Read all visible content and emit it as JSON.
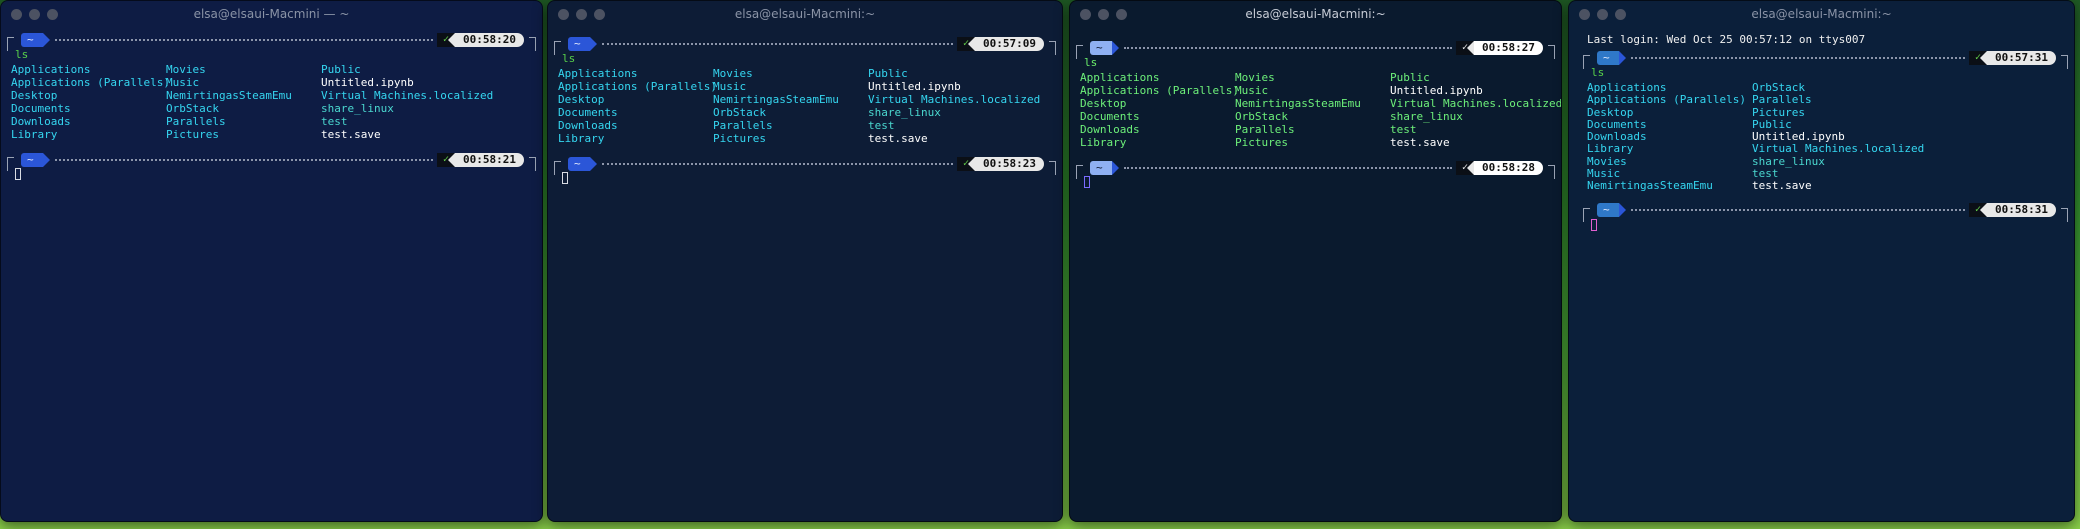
{
  "windows": [
    {
      "title": "elsa@elsaui-Macmini — ~",
      "bg": "#0e1c44",
      "prompt_dir": "~",
      "check": "✓",
      "time1": "00:58:20",
      "command": "ls",
      "time2": "00:58:21",
      "ls": {
        "col1": [
          "Applications",
          "Applications (Parallels)",
          "Desktop",
          "Documents",
          "Downloads",
          "Library"
        ],
        "col2": [
          "Movies",
          "Music",
          "NemirtingasSteamEmu",
          "OrbStack",
          "Parallels",
          "Pictures"
        ],
        "col3": [
          "Public",
          "Untitled.ipynb",
          "Virtual Machines.localized",
          "share_linux",
          "test",
          "test.save"
        ]
      }
    },
    {
      "title": "elsa@elsaui-Macmini:~",
      "bg": "#0d1c36",
      "prompt_dir": "~",
      "check": "✓",
      "time1": "00:57:09",
      "command": "ls",
      "time2": "00:58:23",
      "ls": {
        "col1": [
          "Applications",
          "Applications (Parallels)",
          "Desktop",
          "Documents",
          "Downloads",
          "Library"
        ],
        "col2": [
          "Movies",
          "Music",
          "NemirtingasSteamEmu",
          "OrbStack",
          "Parallels",
          "Pictures"
        ],
        "col3": [
          "Public",
          "Untitled.ipynb",
          "Virtual Machines.localized",
          "share_linux",
          "test",
          "test.save"
        ]
      }
    },
    {
      "title": "elsa@elsaui-Macmini:~",
      "bg": "#0a1a2e",
      "prompt_dir": "~",
      "check": "✓",
      "time1": "00:58:27",
      "command": "ls",
      "time2": "00:58:28",
      "ls": {
        "col1": [
          "Applications",
          "Applications (Parallels)",
          "Desktop",
          "Documents",
          "Downloads",
          "Library"
        ],
        "col2": [
          "Movies",
          "Music",
          "NemirtingasSteamEmu",
          "OrbStack",
          "Parallels",
          "Pictures"
        ],
        "col3": [
          "Public",
          "Untitled.ipynb",
          "Virtual Machines.localized",
          "share_linux",
          "test",
          "test.save"
        ]
      }
    },
    {
      "title": "elsa@elsaui-Macmini:~",
      "bg": "#0b1f3a",
      "login": "Last login: Wed Oct 25 00:57:12 on ttys007",
      "prompt_dir": "~",
      "check": "✓",
      "time1": "00:57:31",
      "command": "ls",
      "time2": "00:58:31",
      "ls": {
        "col1": [
          "Applications",
          "Applications (Parallels)",
          "Desktop",
          "Documents",
          "Downloads",
          "Library",
          "Movies",
          "Music",
          "NemirtingasSteamEmu"
        ],
        "col2": [
          "OrbStack",
          "Parallels",
          "Pictures",
          "Public",
          "Untitled.ipynb",
          "Virtual Machines.localized",
          "share_linux",
          "test",
          "test.save"
        ]
      }
    }
  ]
}
